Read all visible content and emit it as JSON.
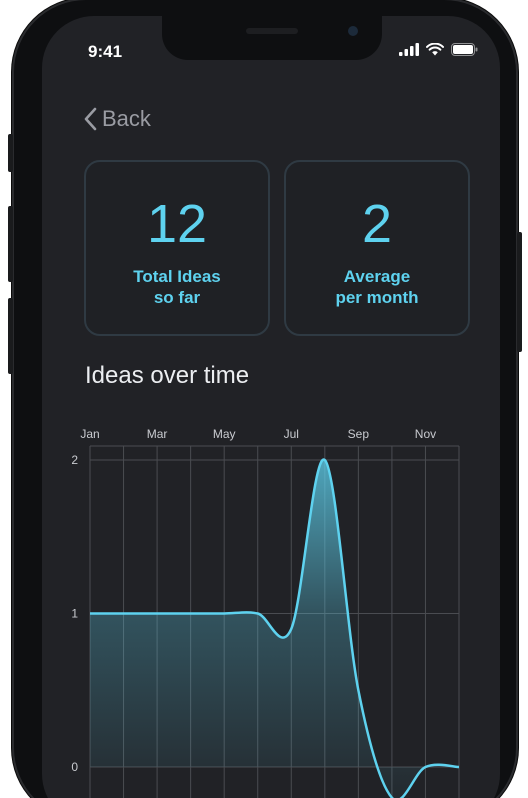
{
  "status_bar": {
    "time": "9:41",
    "icons": [
      "signal-icon",
      "wifi-icon",
      "battery-icon"
    ]
  },
  "nav": {
    "back_label": "Back",
    "back_icon": "chevron-left-icon"
  },
  "stats": [
    {
      "value": "12",
      "label": "Total Ideas\nso far"
    },
    {
      "value": "2",
      "label": "Average\nper month"
    }
  ],
  "section_title": "Ideas over time",
  "colors": {
    "accent": "#5ed2ef",
    "background": "#212226",
    "card_border": "#2f3a43",
    "grid": "#4a4c51"
  },
  "chart_data": {
    "type": "area",
    "title": "Ideas over time",
    "xlabel": "",
    "ylabel": "",
    "x_tick_labels": [
      "Jan",
      "Mar",
      "May",
      "Jul",
      "Sep",
      "Nov"
    ],
    "y_tick_labels": [
      "0",
      "1",
      "2"
    ],
    "x": [
      1,
      2,
      3,
      4,
      5,
      6,
      7,
      8,
      9,
      10,
      11,
      12
    ],
    "series": [
      {
        "values": [
          1,
          1,
          1,
          1,
          1,
          1,
          0.9,
          2,
          0.5,
          -0.2,
          0,
          0
        ]
      }
    ],
    "xlim": [
      1,
      12
    ],
    "ylim": [
      0,
      2
    ],
    "grid": true,
    "legend": "none",
    "curve": "smooth"
  }
}
